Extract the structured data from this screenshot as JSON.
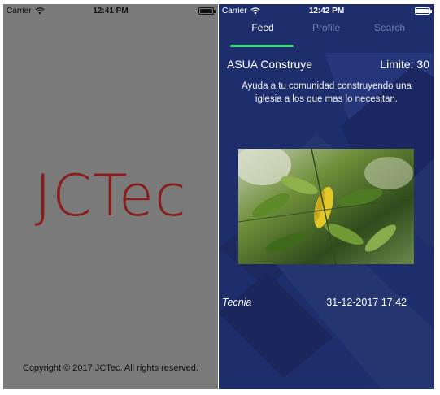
{
  "left_screen": {
    "status": {
      "carrier": "Carrier",
      "time": "12:41 PM"
    },
    "logo_text": "JCTec",
    "copyright": "Copyright © 2017 JCTec. All rights reserved."
  },
  "right_screen": {
    "status": {
      "carrier": "Carrier",
      "time": "12:42 PM"
    },
    "tabs": [
      {
        "label": "Feed",
        "active": true
      },
      {
        "label": "Profile",
        "active": false
      },
      {
        "label": "Search",
        "active": false
      }
    ],
    "post": {
      "title": "ASUA Construye",
      "limit": "Limite: 30",
      "description": "Ayuda a tu comunidad construyendo una iglesia a los que mas lo necesitan.",
      "company": "Tecnia",
      "datetime": "31-12-2017 17:42"
    }
  },
  "colors": {
    "splash_bg": "#7a7a7a",
    "logo": "#8a1c1c",
    "feed_bg": "#1e2e6c",
    "tab_indicator": "#2ee26a",
    "tab_inactive": "#6f7fa8"
  }
}
